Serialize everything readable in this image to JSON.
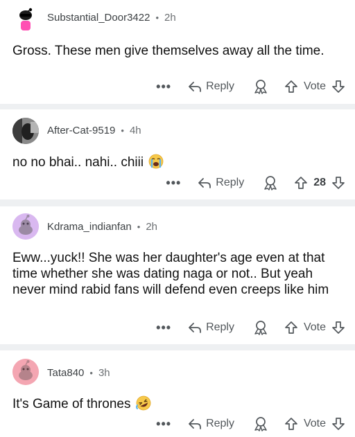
{
  "comments": [
    {
      "username": "Substantial_Door3422",
      "time": "2h",
      "text": "Gross. These men give themselves away all the time.",
      "reply_label": "Reply",
      "vote_label": "Vote",
      "avatar_color": "#ffffff",
      "avatar_accent": "#ff4fb3"
    },
    {
      "username": "After-Cat-9519",
      "time": "4h",
      "text": "no no bhai.. nahi.. chiii",
      "reply_label": "Reply",
      "vote_label": "28",
      "emoji_icon": "crying-face-icon",
      "avatar_color": "#6c6c6c"
    },
    {
      "username": "Kdrama_indianfan",
      "time": "2h",
      "text": "Eww...yuck!! She was her daughter's age even at that time whether she was dating naga or not..  But yeah never mind rabid fans will defend even creeps like him",
      "reply_label": "Reply",
      "vote_label": "Vote",
      "avatar_color": "#d9b8f0"
    },
    {
      "username": "Tata840",
      "time": "3h",
      "text": "It's Game of thrones",
      "reply_label": "Reply",
      "vote_label": "Vote",
      "emoji_icon": "rolling-on-floor-laughing-icon",
      "avatar_color": "#f4a6b2"
    }
  ],
  "separator": "•",
  "more_label": "•••",
  "colors": {
    "text": "#111111",
    "meta": "#6b6f72",
    "separator_band": "#eef0f2"
  }
}
